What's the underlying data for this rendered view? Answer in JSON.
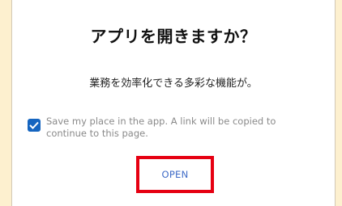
{
  "dialog": {
    "title": "アプリを開きますか？",
    "subtitle": "業務を効率化できる多彩な機能が。",
    "checkbox": {
      "checked": true,
      "label": "Save my place in the app. A link will be copied to continue to this page."
    },
    "open_button": "OPEN"
  },
  "colors": {
    "background": "#fdf0cf",
    "dialog": "#ffffff",
    "checkbox": "#1565c0",
    "button_text": "#3f6bc7",
    "highlight": "#e60012"
  }
}
